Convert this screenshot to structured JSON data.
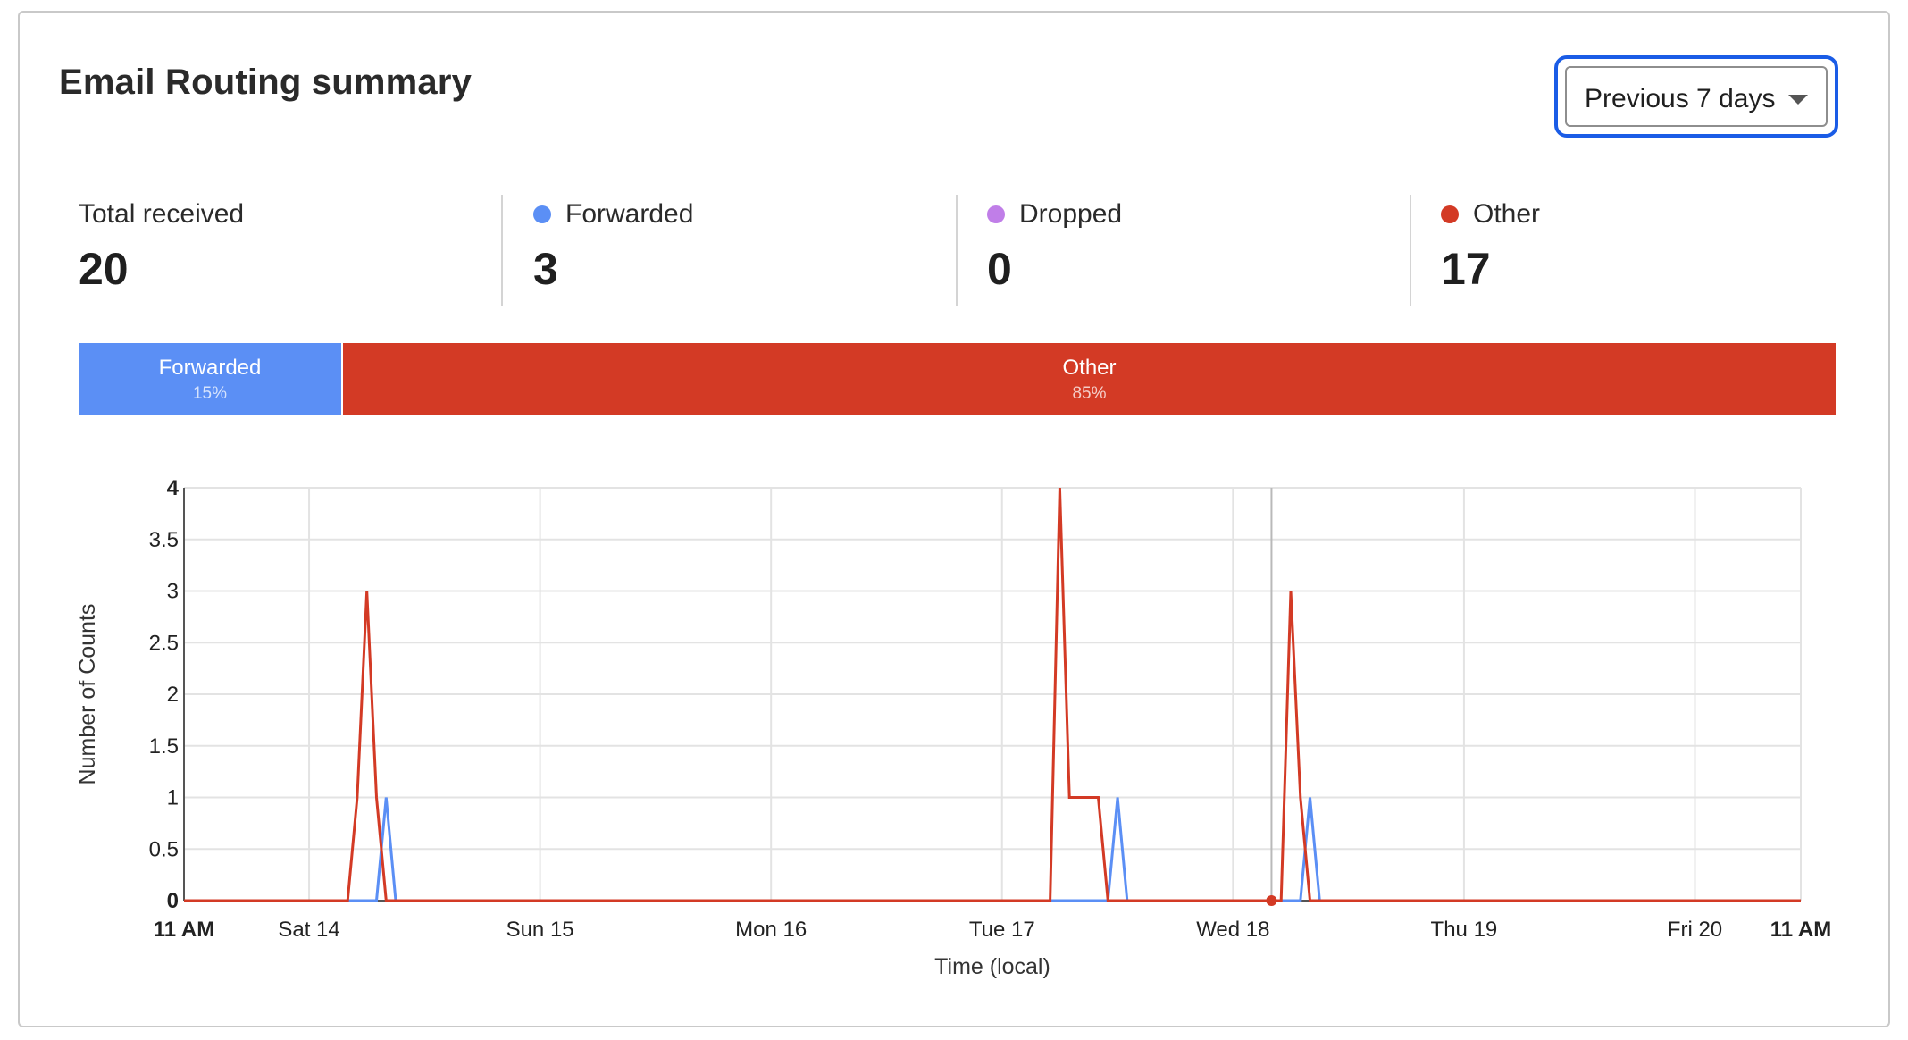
{
  "header": {
    "title": "Email Routing summary"
  },
  "range_select": {
    "label": "Previous 7 days"
  },
  "stats": [
    {
      "label": "Total received",
      "value": "20",
      "color": ""
    },
    {
      "label": "Forwarded",
      "value": "3",
      "color": "#5b8ff5"
    },
    {
      "label": "Dropped",
      "value": "0",
      "color": "#c07ee8"
    },
    {
      "label": "Other",
      "value": "17",
      "color": "#d33a25"
    }
  ],
  "share_bar": [
    {
      "label": "Forwarded",
      "percent": "15%",
      "color": "#5b8ff5"
    },
    {
      "label": "Other",
      "percent": "85%",
      "color": "#d33a25"
    }
  ],
  "chart_data": {
    "type": "line",
    "xlabel": "Time (local)",
    "ylabel": "Number of Counts",
    "ylim": [
      0,
      4
    ],
    "yticks": [
      "0",
      "0.5",
      "1",
      "1.5",
      "2",
      "2.5",
      "3",
      "3.5",
      "4"
    ],
    "xlim_hours": [
      0,
      168
    ],
    "xticks": [
      {
        "hour": 0,
        "label": "11 AM",
        "bold": true
      },
      {
        "hour": 13,
        "label": "Sat 14",
        "bold": false
      },
      {
        "hour": 37,
        "label": "Sun 15",
        "bold": false
      },
      {
        "hour": 61,
        "label": "Mon 16",
        "bold": false
      },
      {
        "hour": 85,
        "label": "Tue 17",
        "bold": false
      },
      {
        "hour": 109,
        "label": "Wed 18",
        "bold": false
      },
      {
        "hour": 133,
        "label": "Thu 19",
        "bold": false
      },
      {
        "hour": 157,
        "label": "Fri 20",
        "bold": false
      },
      {
        "hour": 168,
        "label": "11 AM",
        "bold": true
      }
    ],
    "crosshair_hour": 113,
    "series": [
      {
        "name": "Other",
        "color": "#d33a25",
        "points": [
          [
            0,
            0
          ],
          [
            17,
            0
          ],
          [
            18,
            1
          ],
          [
            19,
            3
          ],
          [
            20,
            1
          ],
          [
            21,
            0
          ],
          [
            90,
            0
          ],
          [
            91,
            4
          ],
          [
            92,
            1
          ],
          [
            95,
            1
          ],
          [
            96,
            0
          ],
          [
            113,
            0
          ],
          [
            114,
            0
          ],
          [
            115,
            3
          ],
          [
            116,
            1
          ],
          [
            117,
            0
          ],
          [
            168,
            0
          ]
        ]
      },
      {
        "name": "Forwarded",
        "color": "#5b8ff5",
        "points": [
          [
            0,
            0
          ],
          [
            20,
            0
          ],
          [
            21,
            1
          ],
          [
            22,
            0
          ],
          [
            96,
            0
          ],
          [
            97,
            1
          ],
          [
            98,
            0
          ],
          [
            116,
            0
          ],
          [
            117,
            1
          ],
          [
            118,
            0
          ],
          [
            168,
            0
          ]
        ]
      }
    ]
  }
}
